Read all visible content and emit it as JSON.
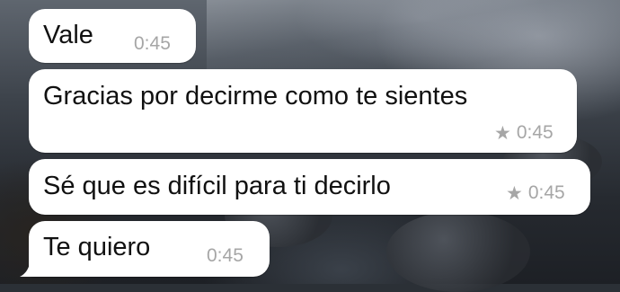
{
  "chat": {
    "messages": [
      {
        "text": "Vale",
        "time": "0:45",
        "starred": false
      },
      {
        "text": "Gracias por decirme como te sientes",
        "time": "0:45",
        "starred": true
      },
      {
        "text": "Sé que es difícil para ti decirlo",
        "time": "0:45",
        "starred": true
      },
      {
        "text": "Te quiero",
        "time": "0:45",
        "starred": false
      }
    ]
  },
  "icons": {
    "star": "star-icon"
  },
  "colors": {
    "bubble": "#ffffff",
    "text": "#111111",
    "timestamp": "#a6a6a6"
  }
}
